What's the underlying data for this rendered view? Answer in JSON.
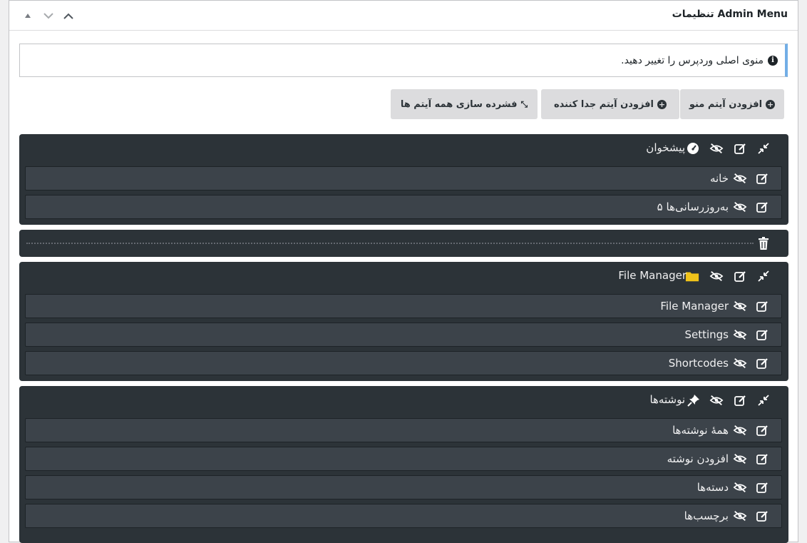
{
  "panel": {
    "title": "Admin Menu تنظیمات"
  },
  "notice": {
    "text": "منوی اصلی وردپرس را تغییر دهید."
  },
  "toolbar": {
    "add_menu_item": "افزودن آیتم منو",
    "add_separator": "افزودن آیتم جدا کننده",
    "collapse_all": "فشرده سازی همه آیتم ها"
  },
  "menu": {
    "dashboard": {
      "label": "پیشخوان",
      "children": [
        "خانه",
        "به‌روزرسانی‌ها ۵"
      ]
    },
    "file_manager": {
      "label": "File Manager",
      "children": [
        "File Manager",
        "Settings",
        "Shortcodes"
      ]
    },
    "posts": {
      "label": "نوشته‌ها",
      "children": [
        "همهٔ نوشته‌ها",
        "افزودن نوشته",
        "دسته‌ها",
        "برچسب‌ها"
      ]
    }
  },
  "colors": {
    "group_bg": "#2c3338",
    "row_bg": "#3c434a",
    "notice_accent": "#72aee6",
    "folder": "#f0c31a"
  },
  "icons": [
    "collapse-icon",
    "edit-icon",
    "eye-slash-icon",
    "dashboard-icon",
    "folder-icon",
    "pin-icon",
    "trash-icon",
    "info-icon",
    "plus-circle-icon"
  ]
}
